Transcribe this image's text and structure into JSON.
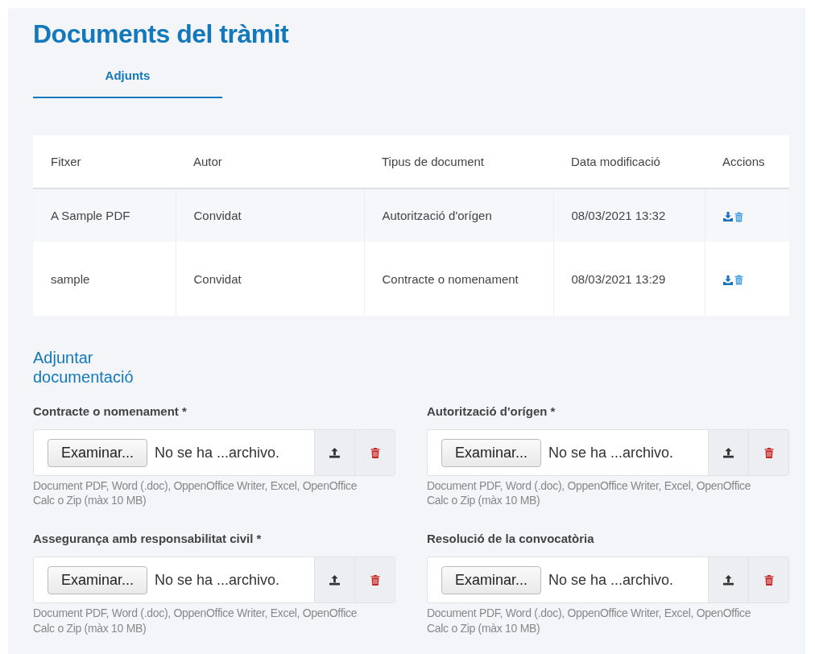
{
  "title": "Documents del tràmit",
  "tabs": [
    {
      "label": "Adjunts",
      "selected": true
    }
  ],
  "table": {
    "columns": [
      "Fitxer",
      "Autor",
      "Tipus de document",
      "Data modificació",
      "Accions"
    ],
    "rows": [
      {
        "cells": [
          "A Sample PDF",
          "Convidat",
          "Autorització d'orígen",
          "08/03/2021 13:32"
        ]
      },
      {
        "cells": [
          "sample",
          "Convidat",
          "Contracte o nomenament",
          "08/03/2021 13:29"
        ]
      }
    ]
  },
  "upload_section": {
    "title": "Adjuntar documentació",
    "fields": [
      {
        "label": "Contracte o nomenament *",
        "browse": "Examinar...",
        "status": "No se ha ...archivo.",
        "help": "Document PDF, Word (.doc), OppenOffice Writer, Excel, OpenOffice Calc o Zip (màx 10 MB)"
      },
      {
        "label": "Autorització d'orígen *",
        "browse": "Examinar...",
        "status": "No se ha ...archivo.",
        "help": "Document PDF, Word (.doc), OppenOffice Writer, Excel, OpenOffice Calc o Zip (màx 10 MB)"
      },
      {
        "label": "Assegurança amb responsabilitat civil *",
        "browse": "Examinar...",
        "status": "No se ha ...archivo.",
        "help": "Document PDF, Word (.doc), OppenOffice Writer, Excel, OpenOffice Calc o Zip (màx 10 MB)"
      },
      {
        "label": "Resolució de la convocatòria",
        "browse": "Examinar...",
        "status": "No se ha ...archivo.",
        "help": "Document PDF, Word (.doc), OppenOffice Writer, Excel, OpenOffice Calc o Zip (màx 10 MB)"
      }
    ]
  }
}
